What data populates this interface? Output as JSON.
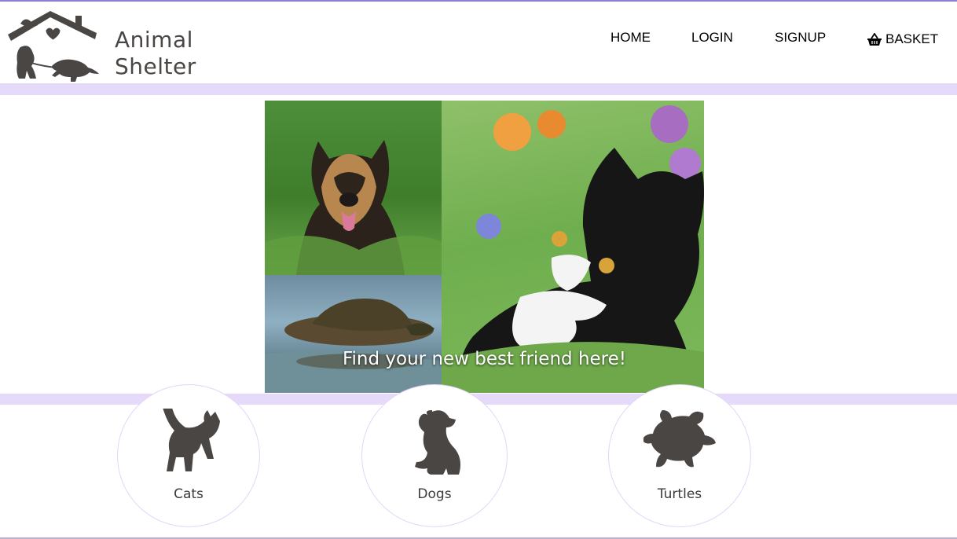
{
  "brand": {
    "line1": "Animal",
    "line2": "Shelter"
  },
  "nav": {
    "home": "HOME",
    "login": "LOGIN",
    "signup": "SIGNUP",
    "basket": "BASKET"
  },
  "hero": {
    "caption": "Find your new best friend here!"
  },
  "categories": [
    {
      "label": "Cats",
      "icon": "cat-silhouette-icon"
    },
    {
      "label": "Dogs",
      "icon": "dog-silhouette-icon"
    },
    {
      "label": "Turtles",
      "icon": "turtle-silhouette-icon"
    }
  ],
  "colors": {
    "accent_band": "#e6dafa",
    "icon_fill": "#4a4644",
    "circle_border": "#e3d6f7"
  }
}
